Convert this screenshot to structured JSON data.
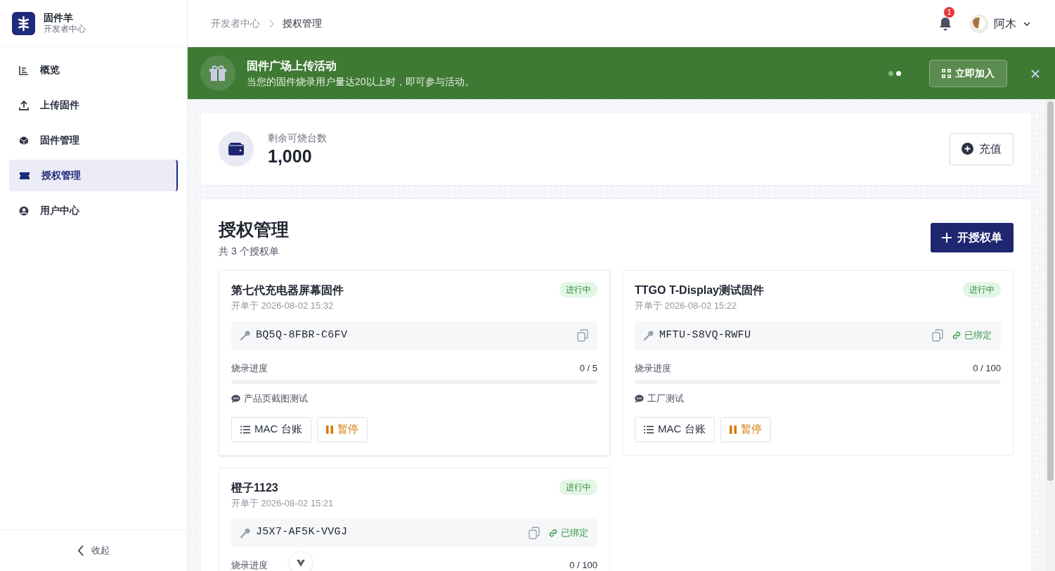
{
  "brand": {
    "name": "固件羊",
    "subtitle": "开发者中心"
  },
  "sidebar": {
    "items": [
      {
        "label": "概览",
        "selected": false
      },
      {
        "label": "上传固件",
        "selected": false
      },
      {
        "label": "固件管理",
        "selected": false
      },
      {
        "label": "授权管理",
        "selected": true
      },
      {
        "label": "用户中心",
        "selected": false
      }
    ],
    "collapse": "收起"
  },
  "breadcrumb": [
    "开发者中心",
    "授权管理"
  ],
  "notifications": {
    "count": "1"
  },
  "user": {
    "name": "阿木"
  },
  "banner": {
    "title": "固件广场上传活动",
    "text": "当您的固件烧录用户量达20以上时，即可参与活动。",
    "dots": [
      {
        "selected": false
      },
      {
        "selected": true
      }
    ],
    "button": "立即加入"
  },
  "balance": {
    "label": "剩余可烧台数",
    "value": "1,000",
    "button": "充值"
  },
  "section": {
    "title": "授权管理",
    "count": "共 3 个授权单",
    "button": "开授权单"
  },
  "licenses": [
    {
      "name": "第七代充电器屏幕固件",
      "opened": "开单于 2026-08-02 15:32",
      "status": "进行中",
      "key": "BQ5Q-8FBR-C6FV",
      "progress_label": "烧录进度",
      "reading": "0 / 5",
      "level": 0,
      "note": "产品页截图测试",
      "buttons": [
        "MAC 台账",
        "暂停"
      ]
    },
    {
      "name": "TTGO T-Display测试固件",
      "opened": "开单于 2026-08-02 15:22",
      "status": "进行中",
      "key": "MFTU-S8VQ-RWFU",
      "binding": "已绑定",
      "progress_label": "烧录进度",
      "reading": "0 / 100",
      "level": 0,
      "note": "工厂测试",
      "buttons": [
        "MAC 台账",
        "暂停"
      ]
    },
    {
      "name": "橙子1123",
      "opened": "开单于 2026-08-02 15:21",
      "status": "进行中",
      "key": "J5X7-AF5K-VVGJ",
      "binding": "已绑定",
      "progress_label": "烧录进度",
      "reading": "0 / 100"
    }
  ]
}
